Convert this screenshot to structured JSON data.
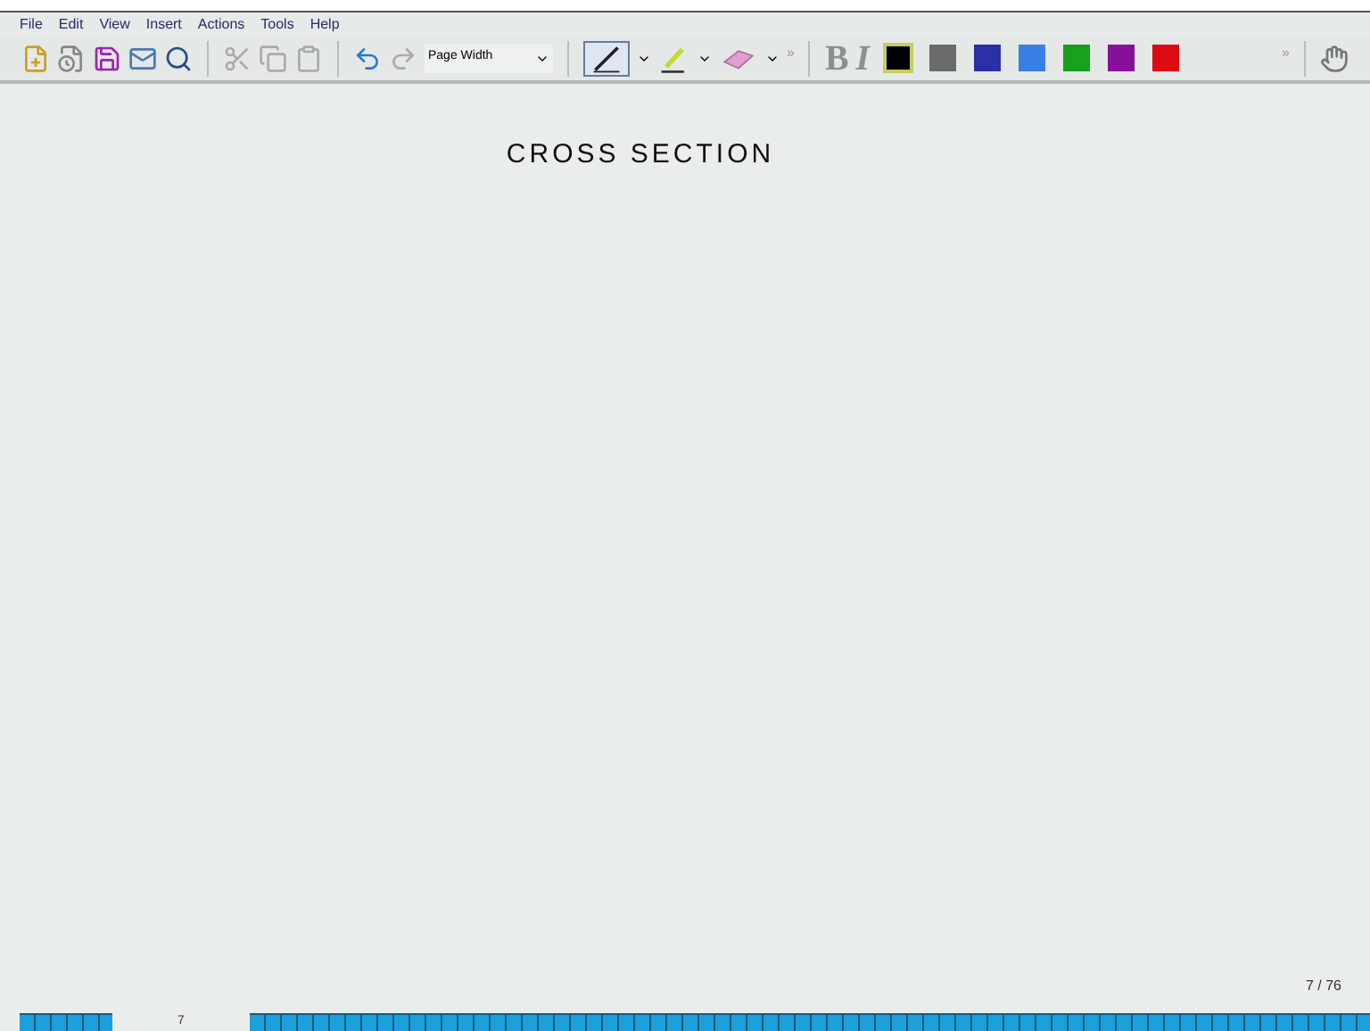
{
  "menu": [
    "File",
    "Edit",
    "View",
    "Insert",
    "Actions",
    "Tools",
    "Help"
  ],
  "toolbar": {
    "zoom": "Page Width",
    "bold": "B",
    "italic": "I",
    "more_1": "»",
    "more_2": "»",
    "colors": [
      {
        "color": "#000000",
        "selected": true
      },
      {
        "color": "#6b6b6b",
        "selected": false
      },
      {
        "color": "#2a2fa8",
        "selected": false
      },
      {
        "color": "#3a7fe6",
        "selected": false
      },
      {
        "color": "#16a01c",
        "selected": false
      },
      {
        "color": "#86109a",
        "selected": false
      },
      {
        "color": "#dc0a12",
        "selected": false
      }
    ]
  },
  "canvas": {
    "heading": "CROSS SECTION",
    "page_counter": "7 / 76"
  },
  "page_strip": {
    "current_page": "7"
  }
}
